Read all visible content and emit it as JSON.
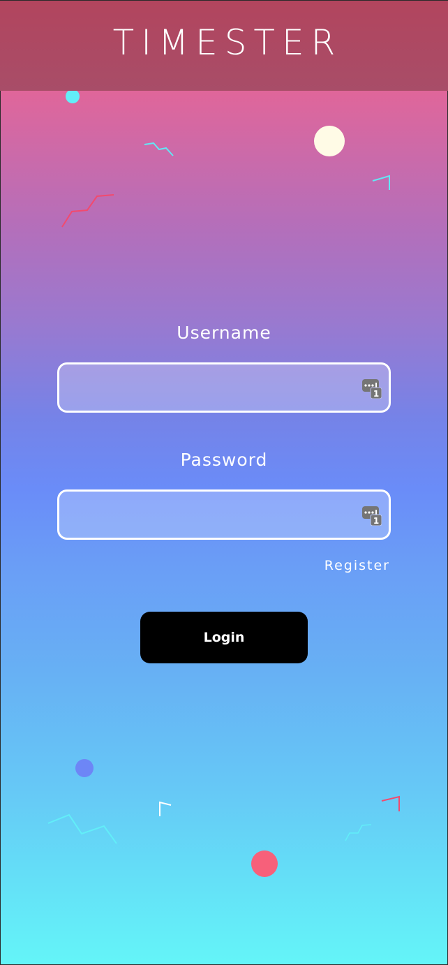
{
  "header": {
    "title": "TIMESTER"
  },
  "form": {
    "username_label": "Username",
    "username_value": "",
    "password_label": "Password",
    "password_value": "",
    "register_label": "Register",
    "login_label": "Login"
  },
  "icons": {
    "username_autofill": "password-autofill-icon",
    "password_autofill": "password-autofill-icon"
  },
  "colors": {
    "header_background": "#a84d68",
    "gradient_top": "#e2649a",
    "gradient_middle": "#6a8cf8",
    "gradient_bottom": "#64f5f8",
    "login_button": "#000000",
    "input_border": "#ffffff",
    "accent_cyan": "#62eef8",
    "accent_cream": "#fffbe6",
    "accent_pink": "#f7607a",
    "accent_blue": "#6d86f6"
  }
}
